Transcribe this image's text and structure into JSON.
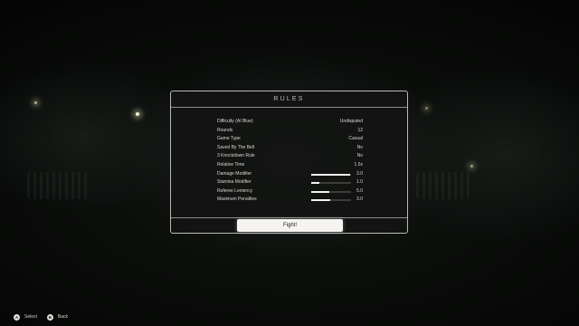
{
  "dialog": {
    "title": "RULES",
    "rules": [
      {
        "label": "Difficulty (AI Blue)",
        "value": "Undisputed"
      },
      {
        "label": "Rounds",
        "value": "12"
      },
      {
        "label": "Game Type",
        "value": "Casual"
      },
      {
        "label": "Saved By The Bell",
        "value": "No"
      },
      {
        "label": "3 Knockdown Rule",
        "value": "No"
      },
      {
        "label": "Relative Time",
        "value": "1.5x"
      },
      {
        "label": "Damage Modifier",
        "value": "3.0",
        "slider_fraction": 0.97
      },
      {
        "label": "Stamina Modifier",
        "value": "1.0",
        "slider_fraction": 0.2
      },
      {
        "label": "Referee Leniency",
        "value": "5.0",
        "slider_fraction": 0.45
      },
      {
        "label": "Maximum Penalties",
        "value": "3.0",
        "slider_fraction": 0.48
      }
    ],
    "fight_label": "Fight!"
  },
  "controls": {
    "select": {
      "icon": "A",
      "label": "Select"
    },
    "back": {
      "icon": "B",
      "label": "Back"
    }
  },
  "colors": {
    "accent": "#f5f4f0",
    "panel_border": "#b9bab6",
    "text": "#d9d9d4"
  }
}
